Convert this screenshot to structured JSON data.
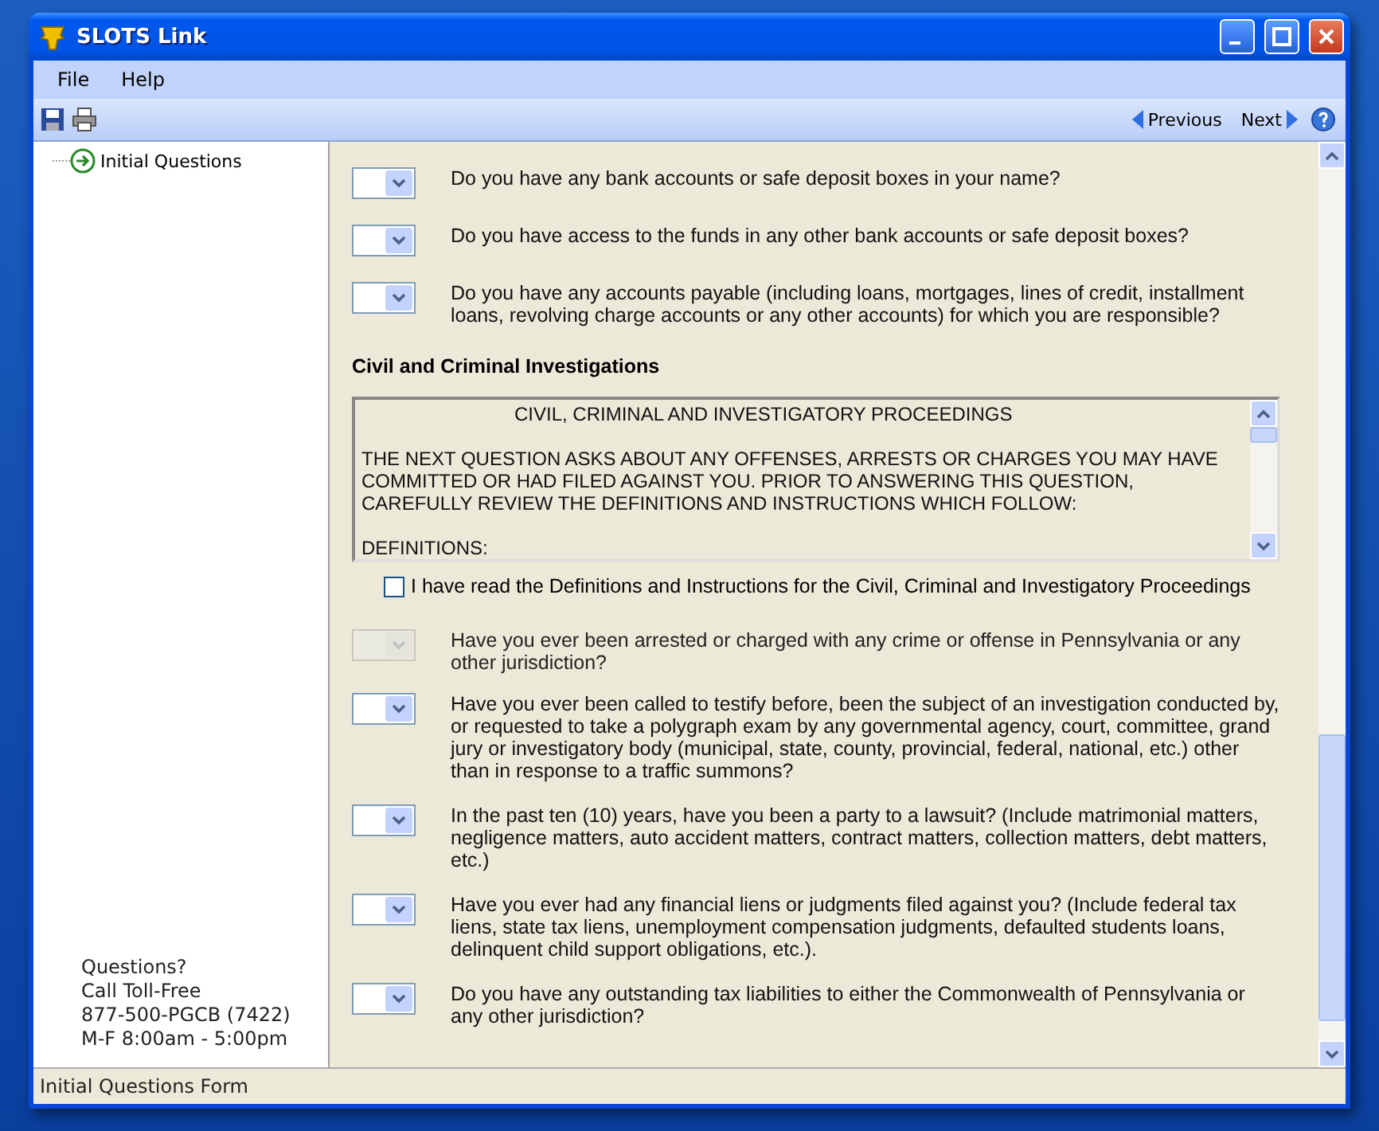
{
  "window": {
    "title": "SLOTS Link"
  },
  "menu": [
    "File",
    "Help"
  ],
  "toolbar": {
    "previous": "Previous",
    "next": "Next"
  },
  "sidebar": {
    "items": [
      {
        "label": "Initial Questions",
        "selected": false
      }
    ],
    "contact": [
      "Questions?",
      "Call Toll-Free",
      "877-500-PGCB (7422)",
      "M-F 8:00am - 5:00pm"
    ]
  },
  "questions": [
    {
      "text": "Do you have any bank accounts or safe deposit boxes in your name?",
      "disabled": false
    },
    {
      "text": "Do you have access to the funds in any other bank accounts or safe deposit boxes?",
      "disabled": false
    },
    {
      "text": "Do you have any accounts payable (including loans, mortgages, lines of credit, installment loans, revolving charge accounts or any other accounts) for which you are responsible?",
      "disabled": false
    }
  ],
  "civil": {
    "heading": "Civil and Criminal Investigations",
    "notice": {
      "title": "CIVIL, CRIMINAL AND INVESTIGATORY PROCEEDINGS",
      "paragraphs": [
        "THE NEXT QUESTION ASKS ABOUT ANY OFFENSES, ARRESTS OR CHARGES YOU MAY HAVE COMMITTED OR HAD FILED AGAINST YOU.  PRIOR TO ANSWERING THIS QUESTION, CAREFULLY REVIEW THE DEFINITIONS AND INSTRUCTIONS WHICH FOLLOW:",
        "DEFINITIONS:"
      ]
    },
    "acknowledgement": {
      "label": "I have read the Definitions and Instructions for the Civil, Criminal and Investigatory Proceedings",
      "checked": false
    },
    "questions": [
      {
        "text": "Have you ever been arrested or charged with any crime or offense in Pennsylvania or any other jurisdiction?",
        "disabled": true
      },
      {
        "text": "Have you ever been called to testify before, been the subject of an investigation conducted by, or requested to take a polygraph exam by any governmental agency, court, committee, grand jury or investigatory body (municipal, state, county, provincial, federal, national, etc.) other than in response to a traffic summons?",
        "disabled": false
      },
      {
        "text": "In the past ten (10) years, have you been a party to a lawsuit? (Include matrimonial matters, negligence matters, auto accident matters, contract matters, collection matters, debt matters, etc.)",
        "disabled": false
      },
      {
        "text": "Have you ever had any financial liens or judgments filed against you? (Include federal tax liens, state tax liens, unemployment compensation judgments, defaulted students loans, delinquent child support obligations, etc.).",
        "disabled": false
      },
      {
        "text": "Do you have any outstanding tax liabilities to either the Commonwealth of Pennsylvania or any other jurisdiction?",
        "disabled": false
      }
    ]
  },
  "status_bar": "Initial Questions Form"
}
